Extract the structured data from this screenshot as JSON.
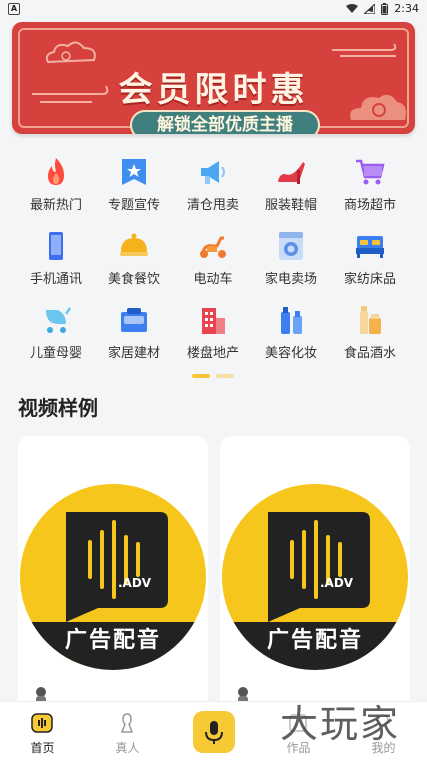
{
  "status_bar": {
    "time": "2:34",
    "left_icon": "A"
  },
  "banner": {
    "title": "会员限时惠",
    "subtitle": "解锁全部优质主播"
  },
  "categories": [
    {
      "label": "最新热门",
      "icon": "fire-icon"
    },
    {
      "label": "专题宣传",
      "icon": "star-badge-icon"
    },
    {
      "label": "清仓甩卖",
      "icon": "megaphone-icon"
    },
    {
      "label": "服装鞋帽",
      "icon": "high-heel-icon"
    },
    {
      "label": "商场超市",
      "icon": "shopping-cart-icon"
    },
    {
      "label": "手机通讯",
      "icon": "phone-icon"
    },
    {
      "label": "美食餐饮",
      "icon": "food-dome-icon"
    },
    {
      "label": "电动车",
      "icon": "scooter-icon"
    },
    {
      "label": "家电卖场",
      "icon": "washing-machine-icon"
    },
    {
      "label": "家纺床品",
      "icon": "bed-icon"
    },
    {
      "label": "儿童母婴",
      "icon": "stroller-icon"
    },
    {
      "label": "家居建材",
      "icon": "furniture-icon"
    },
    {
      "label": "楼盘地产",
      "icon": "building-icon"
    },
    {
      "label": "美容化妆",
      "icon": "cosmetics-icon"
    },
    {
      "label": "食品酒水",
      "icon": "bottle-icon"
    }
  ],
  "section": {
    "title": "视频样例"
  },
  "cards": [
    {
      "cover_text": "广告配音",
      "cover_sub": ".ADV"
    },
    {
      "cover_text": "广告配音",
      "cover_sub": ".ADV"
    }
  ],
  "tabbar": {
    "tabs": [
      {
        "label": "首页",
        "icon": "home-icon",
        "active": true
      },
      {
        "label": "真人",
        "icon": "person-icon",
        "active": false
      },
      {
        "label": "",
        "icon": "mic-icon",
        "active": false
      },
      {
        "label": "作品",
        "icon": "works-icon",
        "active": false
      },
      {
        "label": "我的",
        "icon": "profile-icon",
        "active": false
      }
    ]
  },
  "watermark": "大玩家",
  "colors": {
    "accent": "#f7c934",
    "banner_red": "#d7413d",
    "banner_pill": "#3f7f7d"
  }
}
